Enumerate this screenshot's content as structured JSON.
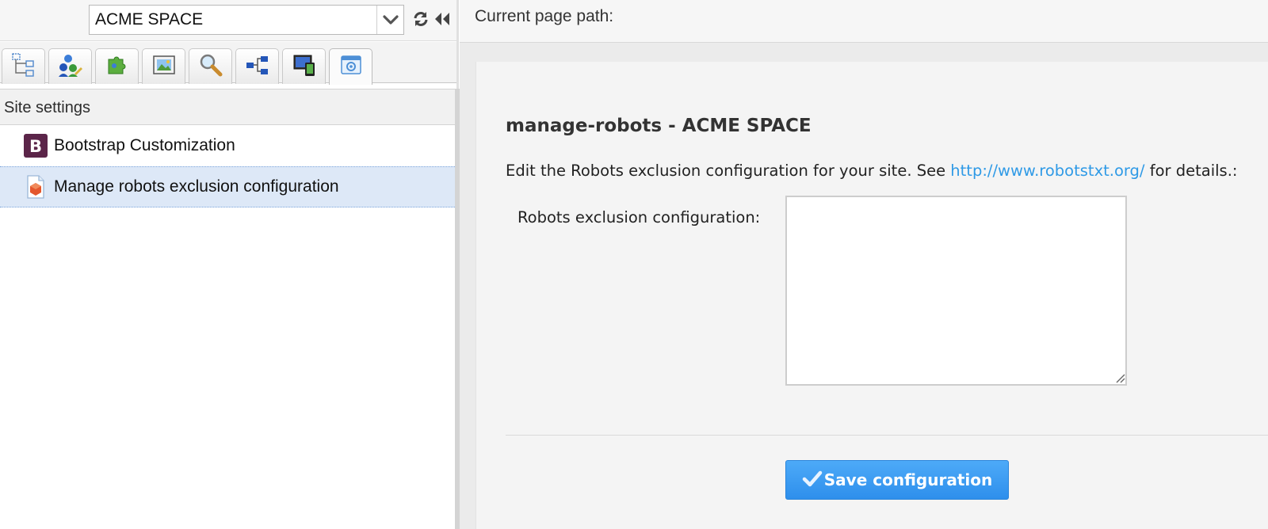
{
  "site_selector": {
    "value": "ACME SPACE"
  },
  "toolbar_icons": {
    "arrow": "chevron-down-icon",
    "refresh": "refresh-icon",
    "collapse": "double-chevron-left-icon"
  },
  "tabs": [
    {
      "icon": "site-structure-icon"
    },
    {
      "icon": "users-icon"
    },
    {
      "icon": "plugins-icon"
    },
    {
      "icon": "media-icon"
    },
    {
      "icon": "search-icon"
    },
    {
      "icon": "workflow-icon"
    },
    {
      "icon": "devices-icon"
    },
    {
      "icon": "site-settings-icon",
      "active": true
    }
  ],
  "tree": {
    "header": "Site settings",
    "items": [
      {
        "label": "Bootstrap Customization",
        "icon": "bootstrap-icon"
      },
      {
        "label": "Manage robots exclusion configuration",
        "icon": "robots-file-icon",
        "selected": true
      }
    ]
  },
  "path_bar": {
    "label": "Current page path:"
  },
  "form": {
    "heading": "manage-robots - ACME SPACE",
    "description_prefix": "Edit the Robots exclusion configuration for your site. See ",
    "description_link": "http://www.robotstxt.org/",
    "description_suffix": " for details.:",
    "field_label": "Robots exclusion configuration:",
    "textarea_value": "",
    "save_label": "Save configuration"
  },
  "colors": {
    "accent": "#2f9ae6",
    "selection": "#dde8f7",
    "button": "#3a9af2"
  }
}
